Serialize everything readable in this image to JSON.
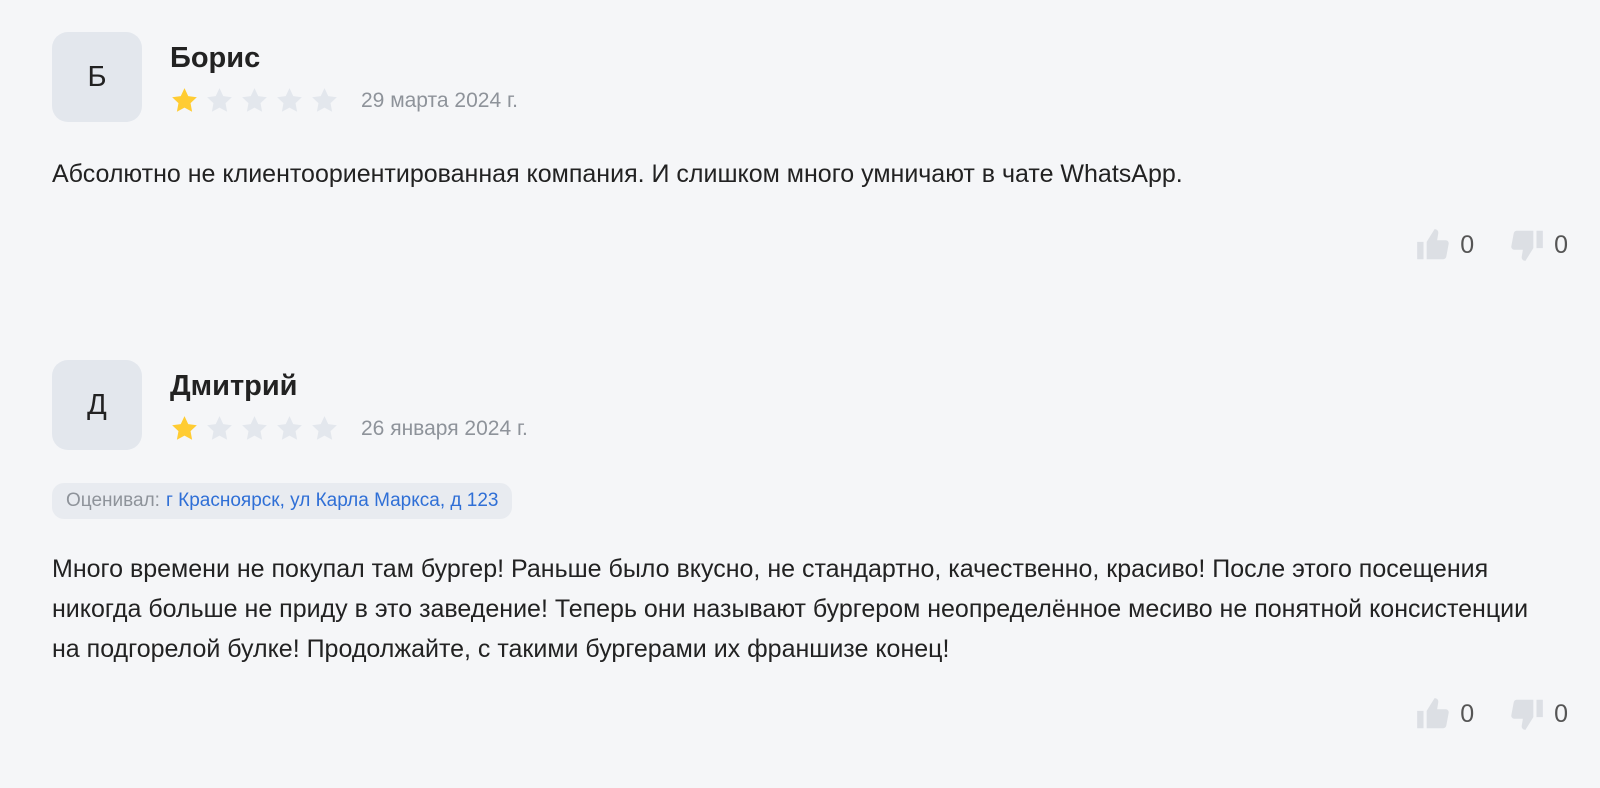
{
  "colors": {
    "star_active": "#ffcc33",
    "star_inactive": "#e3e7ed",
    "link": "#2f6fd6",
    "avatar_bg": "#e3e7ed"
  },
  "reviews": [
    {
      "avatar_letter": "Б",
      "author": "Борис",
      "rating": 1,
      "rating_max": 5,
      "date": "29 марта 2024 г.",
      "text": "Абсолютно не клиентоориентированная компания. И слишком много умничают в чате WhatsApp.",
      "likes": "0",
      "dislikes": "0"
    },
    {
      "avatar_letter": "Д",
      "author": "Дмитрий",
      "rating": 1,
      "rating_max": 5,
      "date": "26 января 2024 г.",
      "location_label": "Оценивал:",
      "location": "г Красноярск, ул Карла Маркса, д 123",
      "text": "Много времени не покупал там бургер! Раньше было вкусно, не стандартно, качественно, красиво! После этого посещения никогда больше не приду в это заведение! Теперь они называют бургером неопределённое месиво не понятной консистенции на подгорелой булке! Продолжайте, с такими бургерами их франшизе конец!",
      "likes": "0",
      "dislikes": "0"
    }
  ]
}
